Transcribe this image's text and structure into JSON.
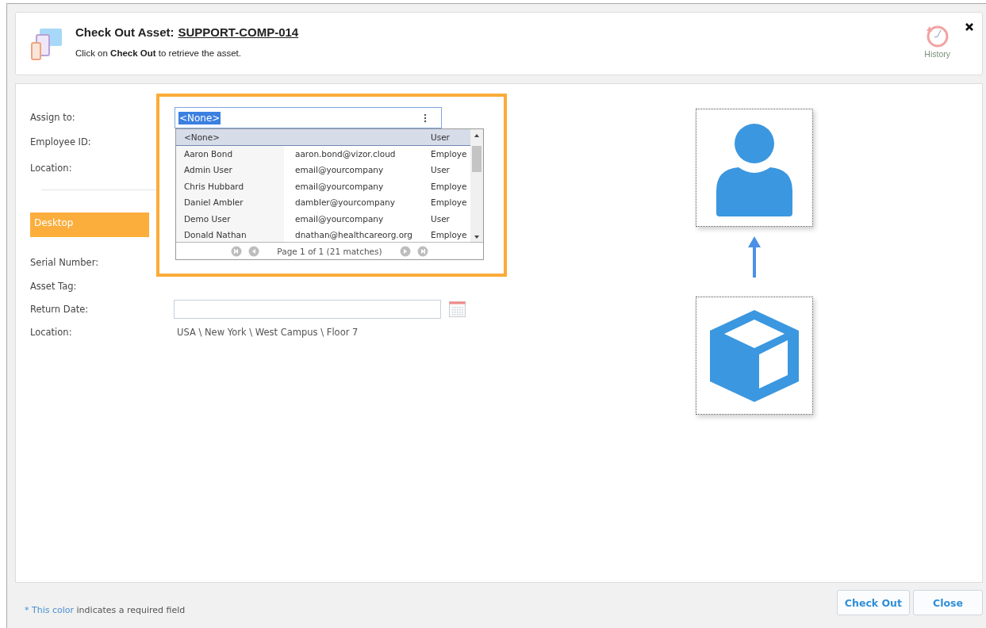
{
  "header": {
    "title": "Check Out Asset:",
    "asset_id": "SUPPORT-COMP-014",
    "instruction": "Click on **Check Out** to retrieve the asset.",
    "history_label": "History"
  },
  "assignee_fields": [
    {
      "label": "Assign to:"
    },
    {
      "label": "Employee ID:"
    },
    {
      "label": "Location:"
    }
  ],
  "assign_field": {
    "value": "<None>"
  },
  "dropdown": {
    "rows": [
      {
        "name": "<None>",
        "type": "User",
        "selected": true
      },
      {
        "name": "Aaron Bond",
        "email": "aaron.bond@vizor.cloud",
        "type": "Employe",
        "selected": false
      },
      {
        "name": "Admin User",
        "email": "email@yourcompany",
        "type": "User",
        "selected": false
      },
      {
        "name": "Chris Hubbard",
        "email": "email@yourcompany",
        "type": "Employe",
        "selected": false
      },
      {
        "name": "Daniel Ambler",
        "email": "dambler@yourcompany",
        "type": "Employe",
        "selected": false
      },
      {
        "name": "Demo User",
        "email": "email@yourcompany",
        "type": "User",
        "selected": false
      },
      {
        "name": "Donald Nathan",
        "email": "dnathan@healthcareorg.org",
        "type": "Employe",
        "selected": false
      }
    ],
    "pager": "Page 1 of 1 (21 matches)"
  },
  "section": {
    "title": "Desktop"
  },
  "asset_fields": [
    {
      "label": "Serial Number:",
      "kind": "text"
    },
    {
      "label": "Asset Tag:",
      "kind": "text"
    },
    {
      "label": "Return Date:",
      "kind": "date"
    },
    {
      "label": "Location:",
      "kind": "text",
      "value": "USA \\ New York \\ West Campus \\ Floor 7"
    }
  ],
  "footer": {
    "required_marker": "* This color",
    "required_note": "indicates a required field",
    "buttons": [
      "Check Out",
      "Close"
    ]
  }
}
